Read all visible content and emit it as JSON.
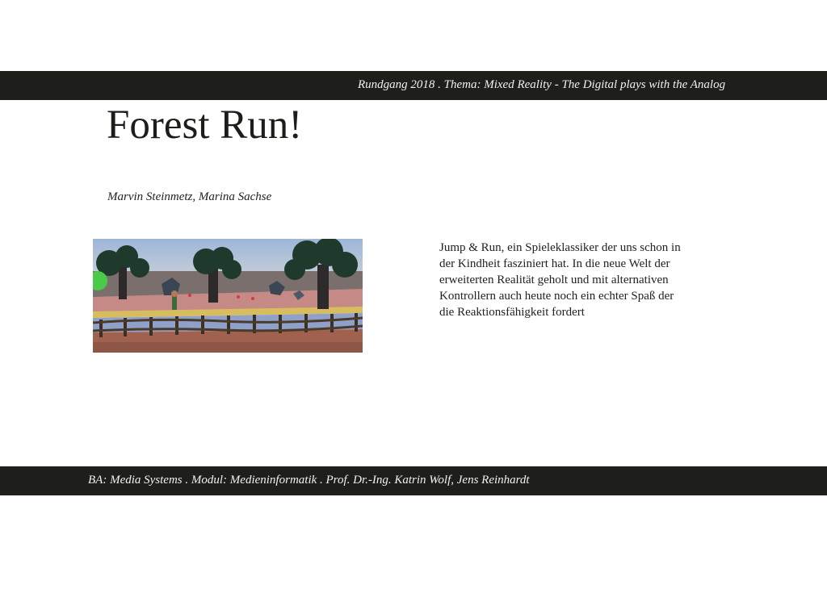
{
  "header": {
    "text": "Rundgang 2018 . Thema: Mixed Reality - The Digital plays with the Analog"
  },
  "project": {
    "title": "Forest Run!",
    "authors": "Marvin Steinmetz, Marina Sachse",
    "description": "Jump & Run, ein Spieleklassiker der uns schon in der Kindheit fasziniert hat. In die neue Welt der erweiterten Realität geholt und mit alternativen Kontrollern auch heute noch ein echter Spaß der die Reaktionsfähigkeit fordert"
  },
  "footer": {
    "text": "BA: Media Systems . Modul: Medieninformatik . Prof. Dr.-Ing. Katrin Wolf, Jens Reinhardt"
  },
  "colors": {
    "bar_background": "#1e1e1b",
    "bar_text": "#f2f2f2",
    "body_text": "#222222"
  }
}
